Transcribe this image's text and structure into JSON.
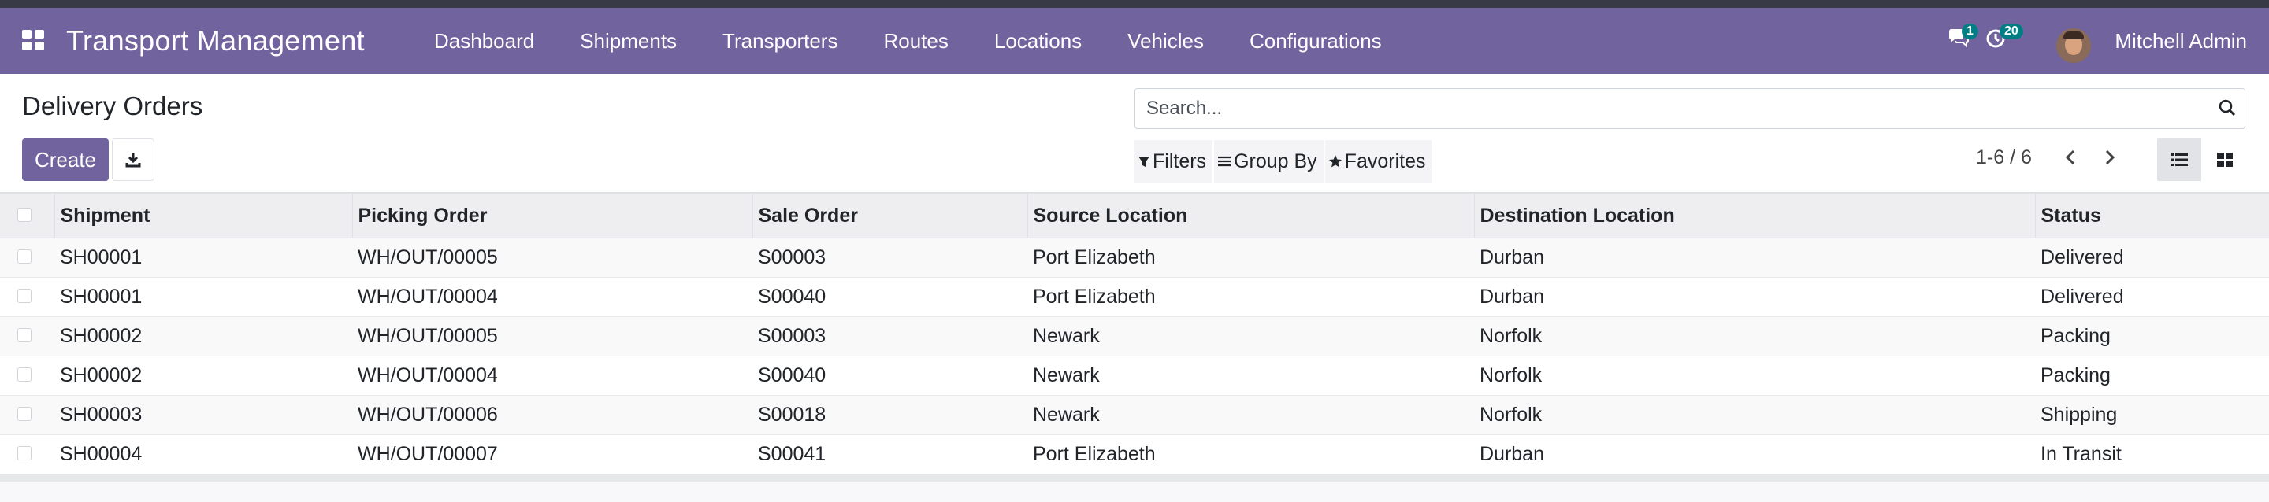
{
  "navbar": {
    "brand": "Transport Management",
    "menu": [
      "Dashboard",
      "Shipments",
      "Transporters",
      "Routes",
      "Locations",
      "Vehicles",
      "Configurations"
    ],
    "messages_count": "1",
    "activities_count": "20",
    "user": "Mitchell Admin"
  },
  "control": {
    "title": "Delivery Orders",
    "create_label": "Create",
    "search_placeholder": "Search...",
    "filters_label": "Filters",
    "groupby_label": "Group By",
    "favorites_label": "Favorites",
    "pager": "1-6 / 6"
  },
  "table": {
    "headers": [
      "Shipment",
      "Picking Order",
      "Sale Order",
      "Source Location",
      "Destination Location",
      "Status"
    ],
    "rows": [
      [
        "SH00001",
        "WH/OUT/00005",
        "S00003",
        "Port Elizabeth",
        "Durban",
        "Delivered"
      ],
      [
        "SH00001",
        "WH/OUT/00004",
        "S00040",
        "Port Elizabeth",
        "Durban",
        "Delivered"
      ],
      [
        "SH00002",
        "WH/OUT/00005",
        "S00003",
        "Newark",
        "Norfolk",
        "Packing"
      ],
      [
        "SH00002",
        "WH/OUT/00004",
        "S00040",
        "Newark",
        "Norfolk",
        "Packing"
      ],
      [
        "SH00003",
        "WH/OUT/00006",
        "S00018",
        "Newark",
        "Norfolk",
        "Shipping"
      ],
      [
        "SH00004",
        "WH/OUT/00007",
        "S00041",
        "Port Elizabeth",
        "Durban",
        "In Transit"
      ]
    ]
  },
  "colors": {
    "brand": "#71639e",
    "badge": "#017e84"
  }
}
